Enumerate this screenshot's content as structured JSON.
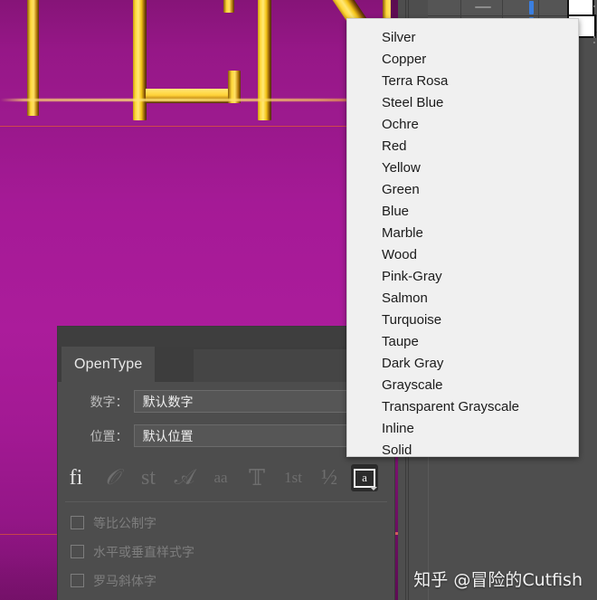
{
  "artwork": {
    "background_color": "#a01b92",
    "letter_color": "#ffd83a",
    "letters_text": "UEN",
    "description": "gold serif letters on magenta gradient"
  },
  "dropdown": {
    "name": "graphic-style-dropdown",
    "items": [
      "Silver",
      "Copper",
      "Terra Rosa",
      "Steel Blue",
      "Ochre",
      "Red",
      "Yellow",
      "Green",
      "Blue",
      "Marble",
      "Wood",
      "Pink-Gray",
      "Salmon",
      "Turquoise",
      "Taupe",
      "Dark Gray",
      "Grayscale",
      "Transparent Grayscale",
      "Inline",
      "Solid"
    ],
    "background_color": "#f0f0f0",
    "text_color": "#1b1b1b"
  },
  "opentype_panel": {
    "tab_label": "OpenType",
    "fields": [
      {
        "label": "数字：",
        "value": "默认数字"
      },
      {
        "label": "位置：",
        "value": "默认位置"
      }
    ],
    "feature_icons": [
      {
        "name": "standard-ligatures-icon",
        "glyph": "fi",
        "enabled": true
      },
      {
        "name": "contextual-alternates-icon",
        "glyph": "𝒪",
        "enabled": false
      },
      {
        "name": "discretionary-ligatures-icon",
        "glyph": "st",
        "enabled": false
      },
      {
        "name": "swash-icon",
        "glyph": "𝒜",
        "enabled": false
      },
      {
        "name": "stylistic-alternates-icon",
        "glyph": "aa",
        "enabled": false
      },
      {
        "name": "titling-alternates-icon",
        "glyph": "𝕋",
        "enabled": false
      },
      {
        "name": "ordinals-icon",
        "glyph": "1st",
        "enabled": false
      },
      {
        "name": "fractions-icon",
        "glyph": "½",
        "enabled": false
      },
      {
        "name": "alternate-glyph-icon",
        "glyph": "a",
        "enabled": true,
        "boxed": true
      }
    ],
    "checkboxes": [
      {
        "label": "等比公制字",
        "checked": false
      },
      {
        "label": "水平或垂直样式字",
        "checked": false
      },
      {
        "label": "罗马斜体字",
        "checked": false
      }
    ],
    "panel_color": "#4d4d4d",
    "label_color": "#bdbdbd"
  },
  "watermark": {
    "text": "知乎 @冒险的Cutfish"
  }
}
